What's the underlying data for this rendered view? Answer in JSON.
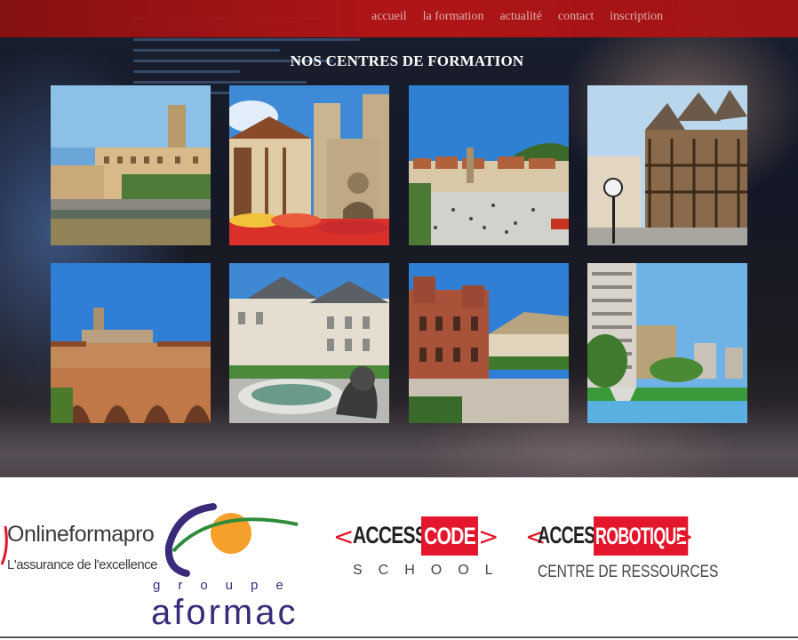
{
  "nav": {
    "items": [
      {
        "label": "accueil"
      },
      {
        "label": "la formation"
      },
      {
        "label": "actualité"
      },
      {
        "label": "contact"
      },
      {
        "label": "inscription"
      }
    ]
  },
  "section": {
    "title": "NOS CENTRES DE FORMATION"
  },
  "colors": {
    "nav_bg": "#b81515",
    "nav_text": "#e9b7b7",
    "title_text": "#ffffff",
    "brand_red": "#e3162b",
    "aformac_purple": "#3b2a7a",
    "aformac_orange": "#f5a02a",
    "aformac_green": "#2e8b3a"
  },
  "centers": {
    "tiles": [
      {
        "icon": "river-city-photo"
      },
      {
        "icon": "cathedral-photo"
      },
      {
        "icon": "town-square-photo"
      },
      {
        "icon": "timber-houses-photo"
      },
      {
        "icon": "bridge-cathedral-photo"
      },
      {
        "icon": "lion-fountain-photo"
      },
      {
        "icon": "red-building-photo"
      },
      {
        "icon": "fountain-park-photo"
      }
    ]
  },
  "partners": {
    "onlineformapro": {
      "name": "Onlineformapro",
      "tagline": "L'assurance de l'excellence"
    },
    "aformac": {
      "top": "groupe",
      "name": "aformac"
    },
    "accesscode": {
      "left": "ACCESS",
      "right": "CODE",
      "sub": "SCHOOL"
    },
    "accessrobotique": {
      "left": "ACCESS",
      "right": "ROBOTIQUE",
      "sub": "CENTRE DE RESSOURCES"
    }
  }
}
